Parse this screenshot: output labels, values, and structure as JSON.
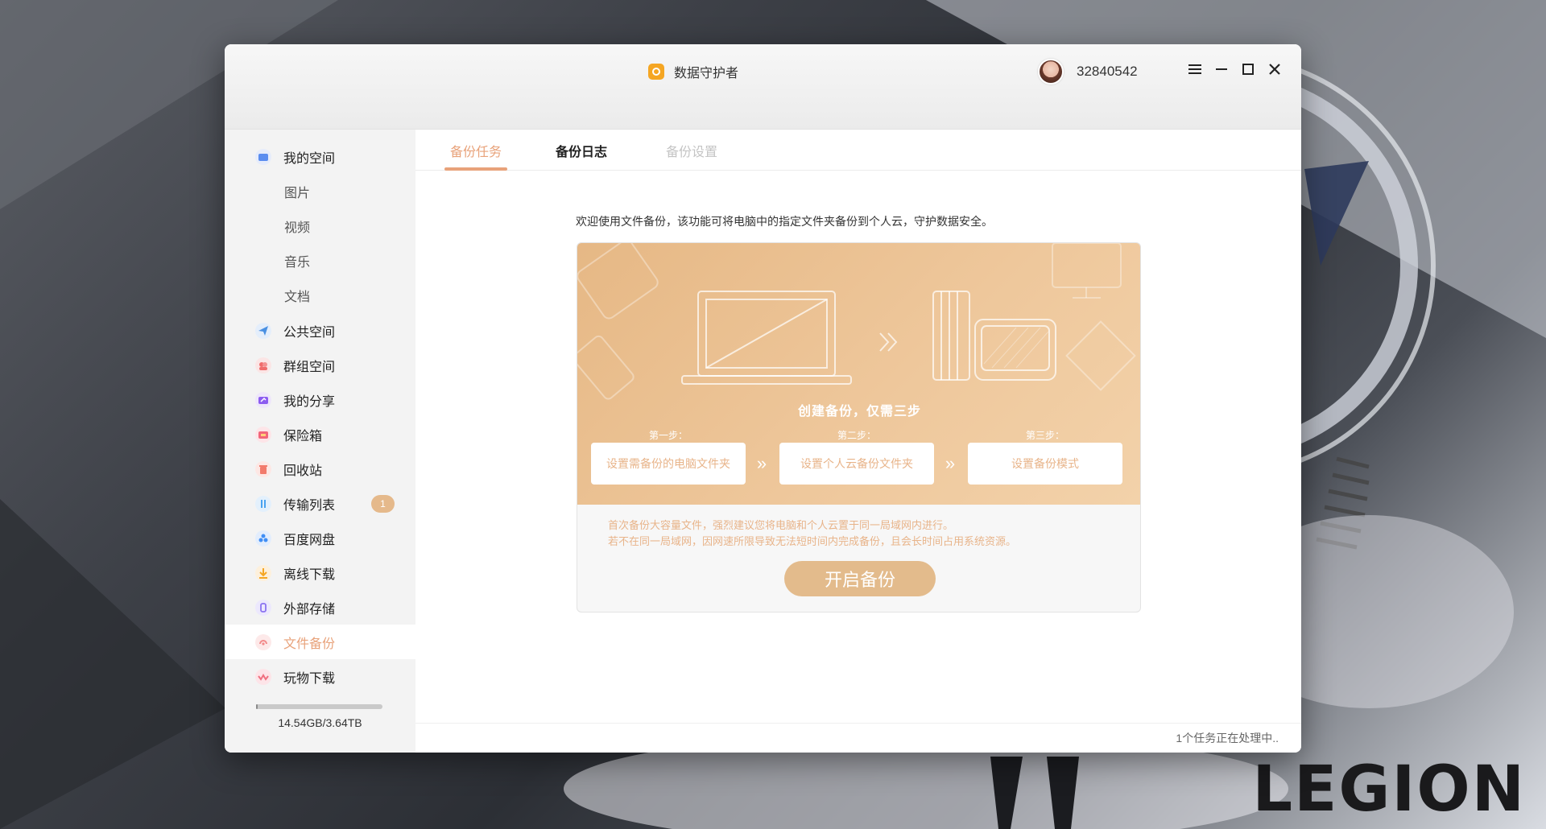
{
  "window": {
    "title": "数据守护者",
    "user_id": "32840542"
  },
  "sidebar": {
    "items": [
      {
        "label": "我的空间",
        "icon": "folder-icon",
        "color": "#5b8def"
      },
      {
        "label": "图片"
      },
      {
        "label": "视频"
      },
      {
        "label": "音乐"
      },
      {
        "label": "文档"
      },
      {
        "label": "公共空间",
        "icon": "paper-plane-icon",
        "color": "#4a90e2"
      },
      {
        "label": "群组空间",
        "icon": "group-icon",
        "color": "#f06b6b"
      },
      {
        "label": "我的分享",
        "icon": "share-icon",
        "color": "#8c5cf0"
      },
      {
        "label": "保险箱",
        "icon": "safe-icon",
        "color": "#f2667a"
      },
      {
        "label": "回收站",
        "icon": "trash-icon",
        "color": "#f27a6b"
      },
      {
        "label": "传输列表",
        "icon": "transfer-icon",
        "color": "#4aa3f0",
        "badge": "1"
      },
      {
        "label": "百度网盘",
        "icon": "cloud-icon",
        "color": "#3f8ef5"
      },
      {
        "label": "离线下载",
        "icon": "download-icon",
        "color": "#f5a623"
      },
      {
        "label": "外部存储",
        "icon": "usb-icon",
        "color": "#8a72f0"
      },
      {
        "label": "文件备份",
        "icon": "backup-icon",
        "color": "#f28a8a"
      },
      {
        "label": "玩物下载",
        "icon": "wave-icon",
        "color": "#f07080"
      }
    ],
    "storage": "14.54GB/3.64TB",
    "storage_used_fraction": 0.004
  },
  "tabs": [
    {
      "label": "备份任务",
      "state": "active"
    },
    {
      "label": "备份日志",
      "state": "bold"
    },
    {
      "label": "备份设置",
      "state": "disabled"
    }
  ],
  "main": {
    "intro": "欢迎使用文件备份，该功能可将电脑中的指定文件夹备份到个人云，守护数据安全。",
    "hero_title": "创建备份，仅需三步",
    "steps": [
      {
        "label": "第一步：",
        "button": "设置需备份的电脑文件夹"
      },
      {
        "label": "第二步：",
        "button": "设置个人云备份文件夹"
      },
      {
        "label": "第三步：",
        "button": "设置备份模式"
      }
    ],
    "step_arrow": "»",
    "note_line1": "首次备份大容量文件，强烈建议您将电脑和个人云置于同一局域网内进行。",
    "note_line2": "若不在同一局域网，因网速所限导致无法短时间内完成备份，且会长时间占用系统资源。",
    "start_button": "开启备份",
    "accent_color": "#e8a27a"
  },
  "footer": {
    "status": "1个任务正在处理中.."
  },
  "wallpaper": {
    "brand": "LEGION"
  }
}
